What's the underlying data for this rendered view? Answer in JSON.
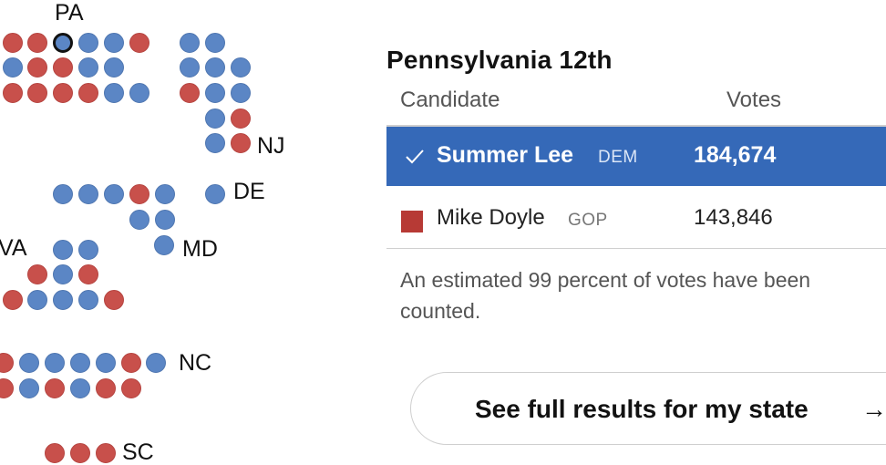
{
  "map": {
    "state_labels": {
      "pa": "PA",
      "nj": "NJ",
      "de": "DE",
      "md": "MD",
      "va": "VA",
      "nc": "NC",
      "sc": "SC"
    },
    "colors": {
      "dem": "#5b86c5",
      "gop": "#c8504b",
      "selected_outline": "#121212"
    }
  },
  "panel": {
    "district_title": "Pennsylvania 12th",
    "columns": {
      "candidate": "Candidate",
      "votes": "Votes"
    },
    "candidates": [
      {
        "name": "Summer Lee",
        "party": "DEM",
        "votes": "184,674",
        "winner": true,
        "color": "#3569b8"
      },
      {
        "name": "Mike Doyle",
        "party": "GOP",
        "votes": "143,846",
        "winner": false,
        "color": "#b73a35"
      }
    ],
    "note": "An estimated 99 percent of votes have been counted.",
    "button_label": "See full results for my state",
    "button_arrow": "→"
  }
}
